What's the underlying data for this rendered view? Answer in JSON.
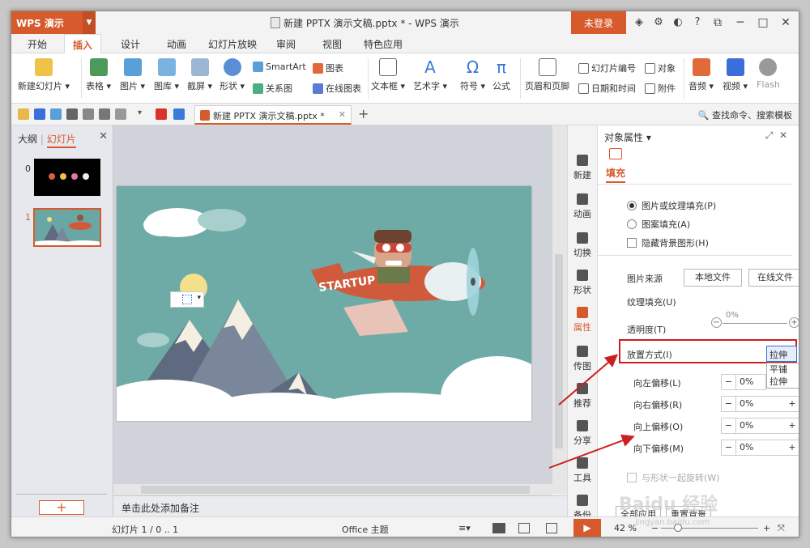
{
  "app": {
    "logo": "WPS 演示",
    "window_title": "新建 PPTX 演示文稿.pptx * - WPS 演示",
    "login_label": "未登录"
  },
  "menu_tabs": [
    "开始",
    "插入",
    "设计",
    "动画",
    "幻灯片放映",
    "审阅",
    "视图",
    "特色应用"
  ],
  "active_tab": "插入",
  "ribbon": {
    "new_slide": "新建幻灯片",
    "table": "表格",
    "picture": "图片",
    "gallery": "图库",
    "screenshot": "截屏",
    "shapes": "形状",
    "smartart": "SmartArt",
    "chart": "图表",
    "relation": "关系图",
    "online_chart": "在线图表",
    "textbox": "文本框",
    "wordart": "艺术字",
    "symbol": "符号",
    "formula": "公式",
    "header_footer": "页眉和页脚",
    "slide_number": "幻灯片编号",
    "datetime": "日期和时间",
    "object": "对象",
    "attachment": "附件",
    "audio": "音频",
    "video": "视频",
    "flash": "Flash"
  },
  "quickbar": {
    "doc_tab": "新建 PPTX 演示文稿.pptx *",
    "search": "查找命令、搜索模板"
  },
  "left_panel": {
    "tab_outline": "大纲",
    "tab_slides": "幻灯片",
    "slide_numbers": [
      "0",
      "1"
    ]
  },
  "notes_placeholder": "单击此处添加备注",
  "slide_text": "STARTUP",
  "vsidebar": [
    "新建",
    "动画",
    "切换",
    "形状",
    "属性",
    "传图",
    "推荐",
    "分享",
    "工具",
    "备份"
  ],
  "props": {
    "title": "对象属性",
    "fill_tab": "填充",
    "opt_picture_fill": "图片或纹理填充(P)",
    "opt_pattern_fill": "图案填充(A)",
    "opt_hide_bg": "隐藏背景图形(H)",
    "image_source": "图片来源",
    "local_file": "本地文件",
    "online_file": "在线文件",
    "texture_fill": "纹理填充(U)",
    "transparency": "透明度(T)",
    "transparency_value": "0%",
    "placement": "放置方式(I)",
    "placement_value": "拉伸",
    "placement_options": [
      "平铺",
      "拉伸"
    ],
    "offset_left": "向左偏移(L)",
    "offset_right": "向右偏移(R)",
    "offset_up": "向上偏移(O)",
    "offset_down": "向下偏移(M)",
    "offset_value": "0%",
    "rotate_with_shape": "与形状一起旋转(W)",
    "apply_all": "全部应用",
    "reset": "重置背景"
  },
  "status": {
    "slide_counter": "幻灯片 1 / 0 .. 1",
    "theme": "Office 主题",
    "zoom": "42 %"
  },
  "watermark": "Baidu 经验",
  "watermark_url": "jingyan.baidu.com",
  "colors": {
    "accent": "#d75a2c",
    "highlight_red": "#cc1f1f",
    "slide_bg": "#6eaba6"
  }
}
